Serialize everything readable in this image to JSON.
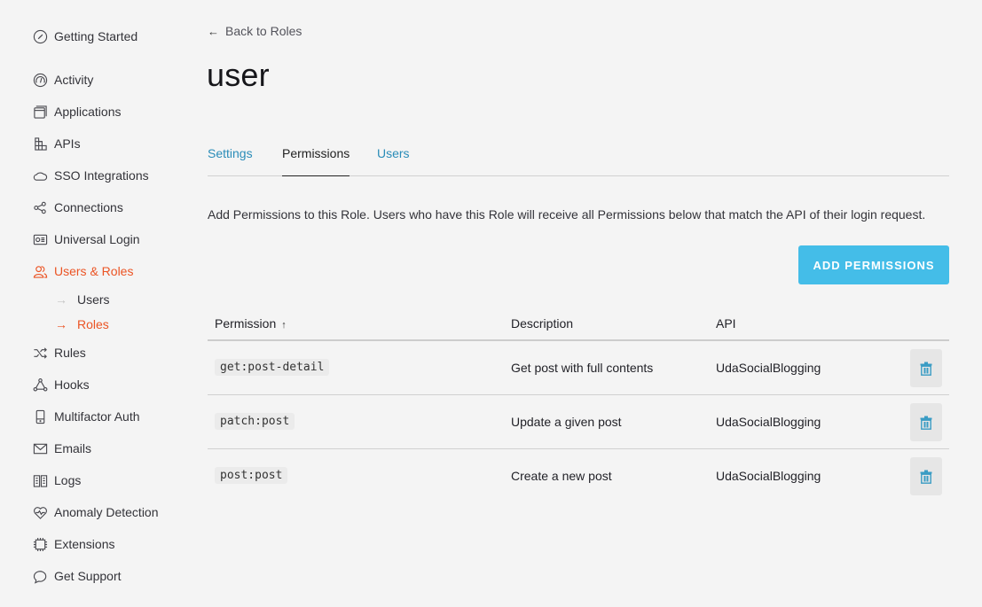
{
  "sidebar": {
    "items": [
      {
        "label": "Getting Started",
        "icon": "compass-icon"
      },
      {
        "label": "Activity",
        "icon": "gauge-icon"
      },
      {
        "label": "Applications",
        "icon": "applications-icon"
      },
      {
        "label": "APIs",
        "icon": "apis-icon"
      },
      {
        "label": "SSO Integrations",
        "icon": "cloud-icon"
      },
      {
        "label": "Connections",
        "icon": "share-icon"
      },
      {
        "label": "Universal Login",
        "icon": "login-card-icon"
      },
      {
        "label": "Users & Roles",
        "icon": "users-icon",
        "active": true
      },
      {
        "label": "Rules",
        "icon": "shuffle-icon"
      },
      {
        "label": "Hooks",
        "icon": "hooks-icon"
      },
      {
        "label": "Multifactor Auth",
        "icon": "phone-icon"
      },
      {
        "label": "Emails",
        "icon": "mail-icon"
      },
      {
        "label": "Logs",
        "icon": "book-icon"
      },
      {
        "label": "Anomaly Detection",
        "icon": "heart-pulse-icon"
      },
      {
        "label": "Extensions",
        "icon": "chip-icon"
      },
      {
        "label": "Get Support",
        "icon": "chat-bubble-icon"
      }
    ],
    "sub_items": [
      {
        "label": "Users",
        "active": false
      },
      {
        "label": "Roles",
        "active": true
      }
    ]
  },
  "header": {
    "back_label": "Back to Roles",
    "title": "user"
  },
  "tabs": [
    {
      "label": "Settings",
      "active": false
    },
    {
      "label": "Permissions",
      "active": true
    },
    {
      "label": "Users",
      "active": false
    }
  ],
  "intro_text": "Add Permissions to this Role. Users who have this Role will receive all Permissions below that match the API of their login request.",
  "add_button_label": "ADD PERMISSIONS",
  "table": {
    "columns": [
      "Permission",
      "Description",
      "API"
    ],
    "sort_indicator": "↑",
    "rows": [
      {
        "permission": "get:post-detail",
        "description": "Get post with full contents",
        "api": "UdaSocialBlogging"
      },
      {
        "permission": "patch:post",
        "description": "Update a given post",
        "api": "UdaSocialBlogging"
      },
      {
        "permission": "post:post",
        "description": "Create a new post",
        "api": "UdaSocialBlogging"
      }
    ]
  },
  "colors": {
    "accent_active": "#eb5424",
    "link": "#2a8cb8",
    "primary_button": "#44bde8",
    "trash_icon": "#3a9cc4"
  }
}
